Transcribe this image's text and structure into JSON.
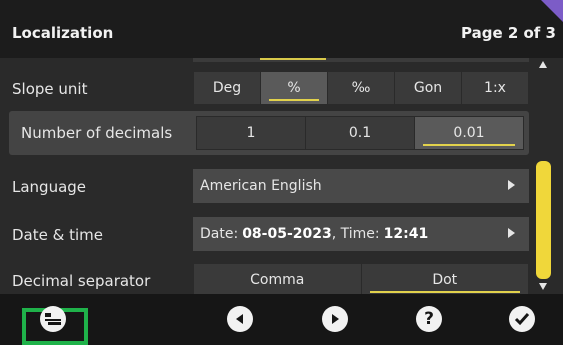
{
  "header": {
    "title": "Localization",
    "page_label": "Page 2 of 3"
  },
  "slope_unit": {
    "label": "Slope unit",
    "options": [
      "Deg",
      "%",
      "‰",
      "Gon",
      "1:x"
    ],
    "selected": "%"
  },
  "decimals": {
    "label": "Number of decimals",
    "options": [
      "1",
      "0.1",
      "0.01"
    ],
    "selected": "0.01"
  },
  "language": {
    "label": "Language",
    "value": "American English"
  },
  "datetime": {
    "label": "Date & time",
    "date_prefix": "Date:",
    "date_value": "08-05-2023",
    "time_prefix": ", Time:",
    "time_value": "12:41"
  },
  "decimal_separator": {
    "label": "Decimal separator",
    "options": [
      "Comma",
      "Dot"
    ],
    "selected": "Dot"
  },
  "footer": {
    "help_label": "?"
  },
  "colors": {
    "accent_yellow": "#e2d24c",
    "scroll_thumb": "#f0d73a",
    "focus_green": "#1fb24a",
    "corner_purple": "#7c5cc7"
  },
  "icons": [
    "menu-icon",
    "previous-icon",
    "next-icon",
    "help-icon",
    "confirm-icon"
  ]
}
